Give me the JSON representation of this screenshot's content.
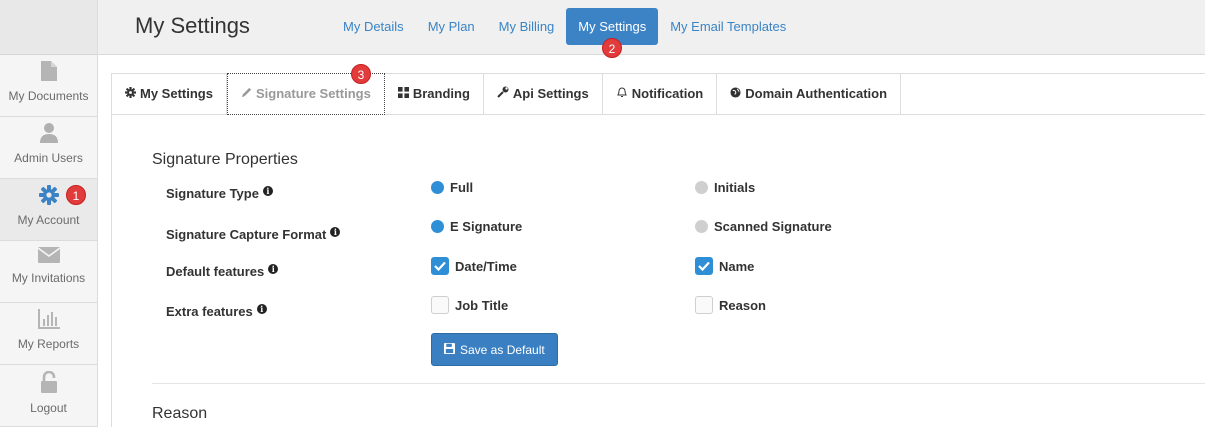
{
  "sidebar": {
    "items": [
      {
        "label": "My Documents",
        "icon": "document-icon"
      },
      {
        "label": "Admin Users",
        "icon": "user-icon"
      },
      {
        "label": "My Account",
        "icon": "gear-icon"
      },
      {
        "label": "My Invitations",
        "icon": "envelope-icon"
      },
      {
        "label": "My Reports",
        "icon": "bar-chart-icon"
      },
      {
        "label": "Logout",
        "icon": "unlock-icon"
      }
    ]
  },
  "header": {
    "title": "My Settings",
    "nav": [
      "My Details",
      "My Plan",
      "My Billing",
      "My Settings",
      "My Email Templates"
    ],
    "active_nav": "My Settings"
  },
  "tabs": [
    {
      "label": "My Settings",
      "icon": "gear-icon"
    },
    {
      "label": "Signature Settings",
      "icon": "pencil-icon"
    },
    {
      "label": "Branding",
      "icon": "grid-icon"
    },
    {
      "label": "Api Settings",
      "icon": "wrench-icon"
    },
    {
      "label": "Notification",
      "icon": "bell-icon"
    },
    {
      "label": "Domain Authentication",
      "icon": "globe-icon"
    }
  ],
  "active_tab": "Signature Settings",
  "badges": {
    "one": "1",
    "two": "2",
    "three": "3"
  },
  "signature_properties": {
    "title": "Signature Properties",
    "signature_type": {
      "label": "Signature Type",
      "full": "Full",
      "initials": "Initials",
      "selected": "Full"
    },
    "capture_format": {
      "label": "Signature Capture Format",
      "e_signature": "E Signature",
      "scanned": "Scanned Signature",
      "selected": "E Signature"
    },
    "default_features": {
      "label": "Default features",
      "date_time": "Date/Time",
      "name": "Name",
      "date_time_checked": true,
      "name_checked": true
    },
    "extra_features": {
      "label": "Extra features",
      "job_title": "Job Title",
      "reason": "Reason",
      "job_title_checked": false,
      "reason_checked": false
    },
    "save_label": "Save as Default"
  },
  "reason_section": {
    "title": "Reason"
  },
  "colors": {
    "accent": "#3c83c5",
    "badge": "#e23b3b",
    "radio_on": "#2f8fd6"
  }
}
